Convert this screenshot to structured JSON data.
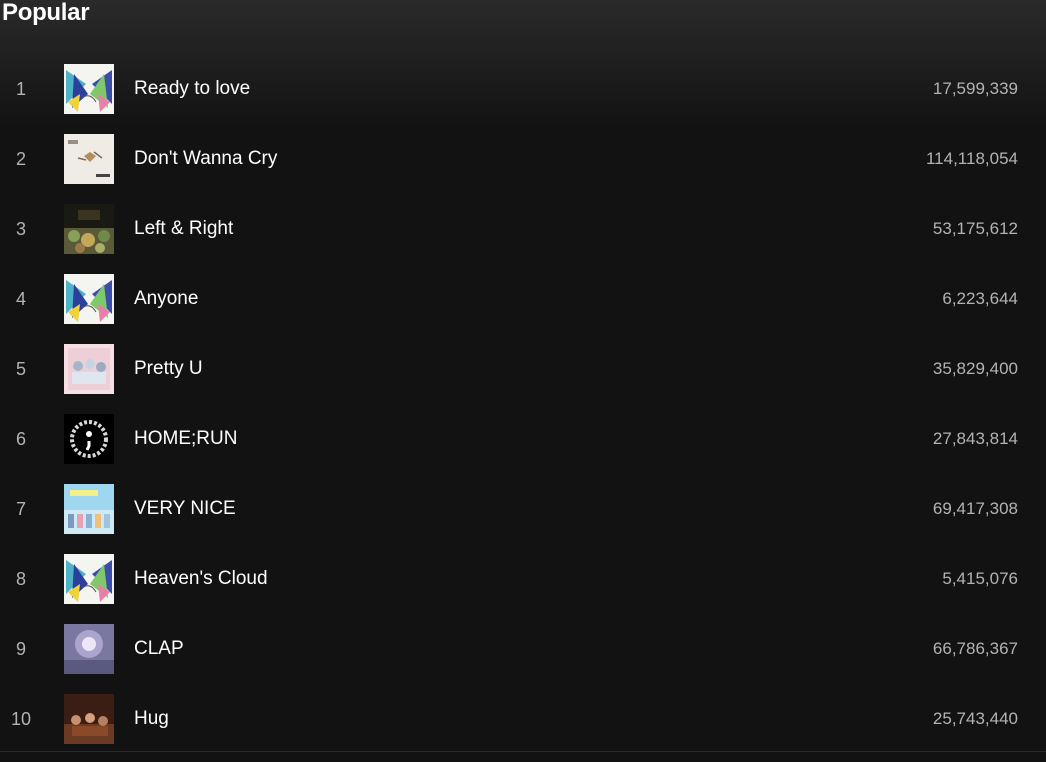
{
  "section": {
    "title": "Popular"
  },
  "tracks": [
    {
      "index": "1",
      "title": "Ready to love",
      "plays": "17,599,339"
    },
    {
      "index": "2",
      "title": "Don't Wanna Cry",
      "plays": "114,118,054"
    },
    {
      "index": "3",
      "title": "Left & Right",
      "plays": "53,175,612"
    },
    {
      "index": "4",
      "title": "Anyone",
      "plays": "6,223,644"
    },
    {
      "index": "5",
      "title": "Pretty U",
      "plays": "35,829,400"
    },
    {
      "index": "6",
      "title": "HOME;RUN",
      "plays": "27,843,814"
    },
    {
      "index": "7",
      "title": "VERY NICE",
      "plays": "69,417,308"
    },
    {
      "index": "8",
      "title": "Heaven's Cloud",
      "plays": "5,415,076"
    },
    {
      "index": "9",
      "title": "CLAP",
      "plays": "66,786,367"
    },
    {
      "index": "10",
      "title": "Hug",
      "plays": "25,743,440"
    }
  ],
  "colors": {
    "background": "#121212",
    "primary_text": "#ffffff",
    "secondary_text": "#b3b3b3"
  }
}
